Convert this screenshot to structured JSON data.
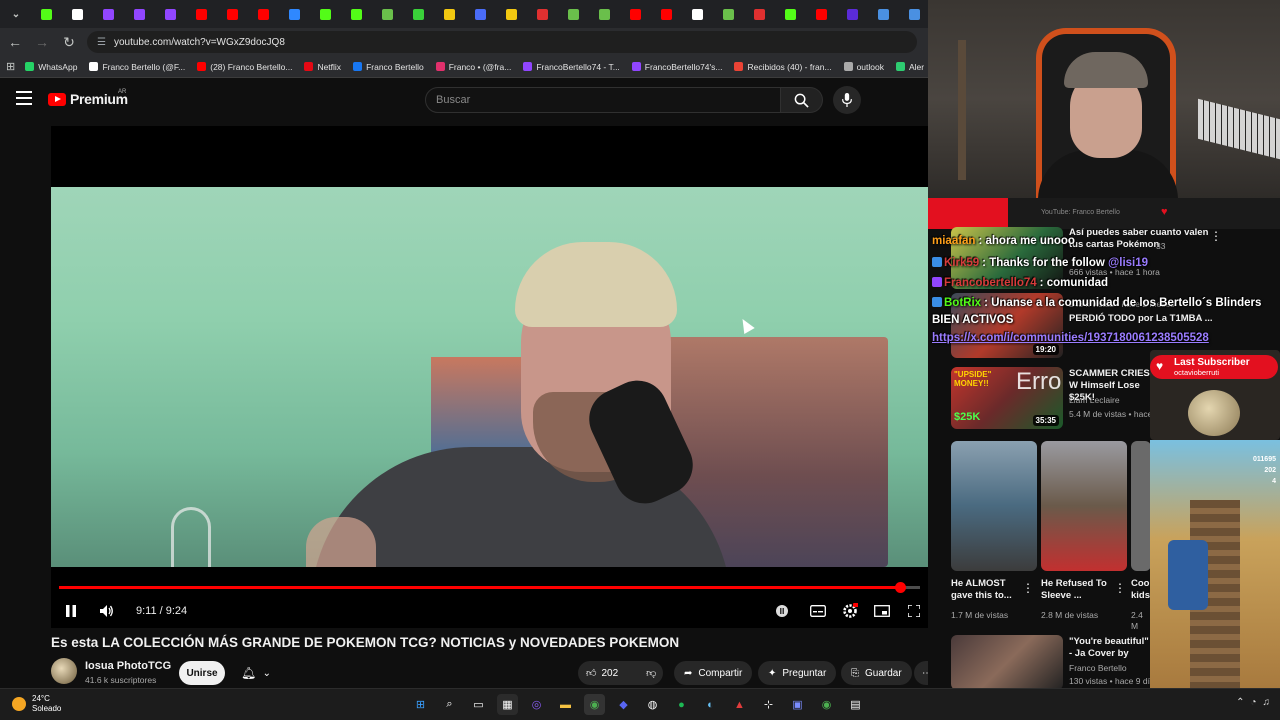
{
  "browser": {
    "tabs": [
      {
        "icon": "kick-icon",
        "color": "#53fc18"
      },
      {
        "icon": "github-icon",
        "color": "#ffffff"
      },
      {
        "icon": "twitch-icon",
        "color": "#9146ff"
      },
      {
        "icon": "twitch-icon",
        "color": "#9146ff"
      },
      {
        "icon": "twitch-icon",
        "color": "#9146ff"
      },
      {
        "icon": "youtube-icon",
        "color": "#ff0000"
      },
      {
        "icon": "youtube-icon",
        "color": "#ff0000"
      },
      {
        "icon": "youtube-icon",
        "color": "#ff0000"
      },
      {
        "icon": "edge-icon",
        "color": "#2f88ff"
      },
      {
        "icon": "kick-icon",
        "color": "#53fc18"
      },
      {
        "icon": "kick-icon",
        "color": "#53fc18"
      },
      {
        "icon": "xbox-icon",
        "color": "#6abf4b"
      },
      {
        "icon": "gamepad-icon",
        "color": "#3ad13a"
      },
      {
        "icon": "note-icon",
        "color": "#f2c811"
      },
      {
        "icon": "dots-icon",
        "color": "#4a6cf7"
      },
      {
        "icon": "note-icon",
        "color": "#f2c811"
      },
      {
        "icon": "pokeball-icon",
        "color": "#e03030"
      },
      {
        "icon": "xbox-icon",
        "color": "#6abf4b"
      },
      {
        "icon": "xbox-icon",
        "color": "#6abf4b"
      },
      {
        "icon": "youtube-icon",
        "color": "#ff0000"
      },
      {
        "icon": "youtube-icon",
        "color": "#ff0000"
      },
      {
        "icon": "x-icon",
        "color": "#ffffff"
      },
      {
        "icon": "xbox-icon",
        "color": "#6abf4b"
      },
      {
        "icon": "pokeball-icon",
        "color": "#e03030"
      },
      {
        "icon": "kick-icon",
        "color": "#53fc18"
      },
      {
        "icon": "youtube-icon",
        "color": "#ff0000"
      },
      {
        "icon": "square-icon",
        "color": "#5b2bd8"
      },
      {
        "icon": "chart-icon",
        "color": "#4a90e2"
      },
      {
        "icon": "chart-icon",
        "color": "#4a90e2"
      }
    ],
    "url": "youtube.com/watch?v=WGxZ9docJQ8",
    "bookmarks": [
      {
        "label": "WhatsApp",
        "color": "#25d366"
      },
      {
        "label": "Franco Bertello (@F...",
        "color": "#ffffff"
      },
      {
        "label": "(28) Franco Bertello...",
        "color": "#ff0000"
      },
      {
        "label": "Netflix",
        "color": "#e50914"
      },
      {
        "label": "Franco Bertello",
        "color": "#1877f2"
      },
      {
        "label": "Franco • (@fra...",
        "color": "#e1306c"
      },
      {
        "label": "FrancoBertello74 - T...",
        "color": "#9146ff"
      },
      {
        "label": "FrancoBertello74's...",
        "color": "#9146ff"
      },
      {
        "label": "Recibidos (40) - fran...",
        "color": "#ea4335"
      },
      {
        "label": "outlook",
        "color": "#aaaaaa"
      },
      {
        "label": "Aler",
        "color": "#2ecc71"
      }
    ]
  },
  "youtube": {
    "logo": "Premium",
    "region": "AR",
    "search_placeholder": "Buscar",
    "player": {
      "current_time": "9:11",
      "duration": "9:24",
      "time_label": "9:11 / 9:24",
      "progress": 0.977
    },
    "video_title": "Es esta LA COLECCIÓN MÁS GRANDE DE POKEMON TCG? NOTICIAS y NOVEDADES POKEMON",
    "channel": {
      "name": "Iosua PhotoTCG",
      "subscribers": "41.6 k suscriptores",
      "join_label": "Unirse"
    },
    "actions": {
      "likes": "202",
      "share": "Compartir",
      "ask": "Preguntar",
      "save": "Guardar"
    }
  },
  "stream_overlay": {
    "strip_label": "YouTube: Franco Bertello",
    "chat": [
      {
        "user": "miaafan",
        "user_color": "#ff9f1a",
        "text": ": ahora me unooo"
      },
      {
        "user": "Kirk59",
        "user_color": "#d63b3b",
        "text": ": Thanks for the follow ",
        "mention": "@lisi19"
      },
      {
        "user": "Francobertello74",
        "user_color": "#d63b3b",
        "text": ": comunidad"
      },
      {
        "user": "BotRix",
        "user_color": "#53fc18",
        "text": ": Unanse a la comunidad de los Bertello´s Blinders"
      },
      {
        "user": "",
        "user_color": "#ffffff",
        "text": "BIEN ACTIVOS"
      },
      {
        "user": "",
        "user_color": "#ffffff",
        "text": "https://x.com/i/communities/1937180061238505528"
      }
    ],
    "recommendations": [
      {
        "title": "Así puedes saber cuanto valen tus cartas Pokémon",
        "meta": "666 vistas • hace 1 hora",
        "count": "33"
      },
      {
        "title": "PERDIÓ TODO por La T1MBA ...",
        "meta": "248 k vistas • hace 2 meses",
        "duration": "19:20"
      },
      {
        "title": "SCAMMER CRIES W Himself Lose $25K!",
        "channel": "Liam Leclaire",
        "meta": "5.4 M de vistas • hace",
        "duration": "35:35",
        "thumb_text": "$25K",
        "thumb_label": "\"UPSIDE\" MONEY!!"
      },
      {
        "title": "He ALMOST gave this to...",
        "meta": "1.7 M de vistas"
      },
      {
        "title": "He Refused To Sleeve ...",
        "meta": "2.8 M de vistas"
      },
      {
        "title": "Coop kids",
        "meta": "2.4 M"
      },
      {
        "title": "\"You're beautiful\" - Ja Cover by FRANCO BE",
        "channel": "Franco Bertello",
        "meta": "130 vistas • hace 9 días"
      }
    ],
    "error_text": "Erro",
    "last_sub": {
      "title": "Last Subscriber",
      "name": "octavioberruti"
    },
    "game_hud": [
      "011695",
      "202",
      "4"
    ]
  },
  "taskbar": {
    "temperature": "24°C",
    "condition": "Soleado"
  }
}
